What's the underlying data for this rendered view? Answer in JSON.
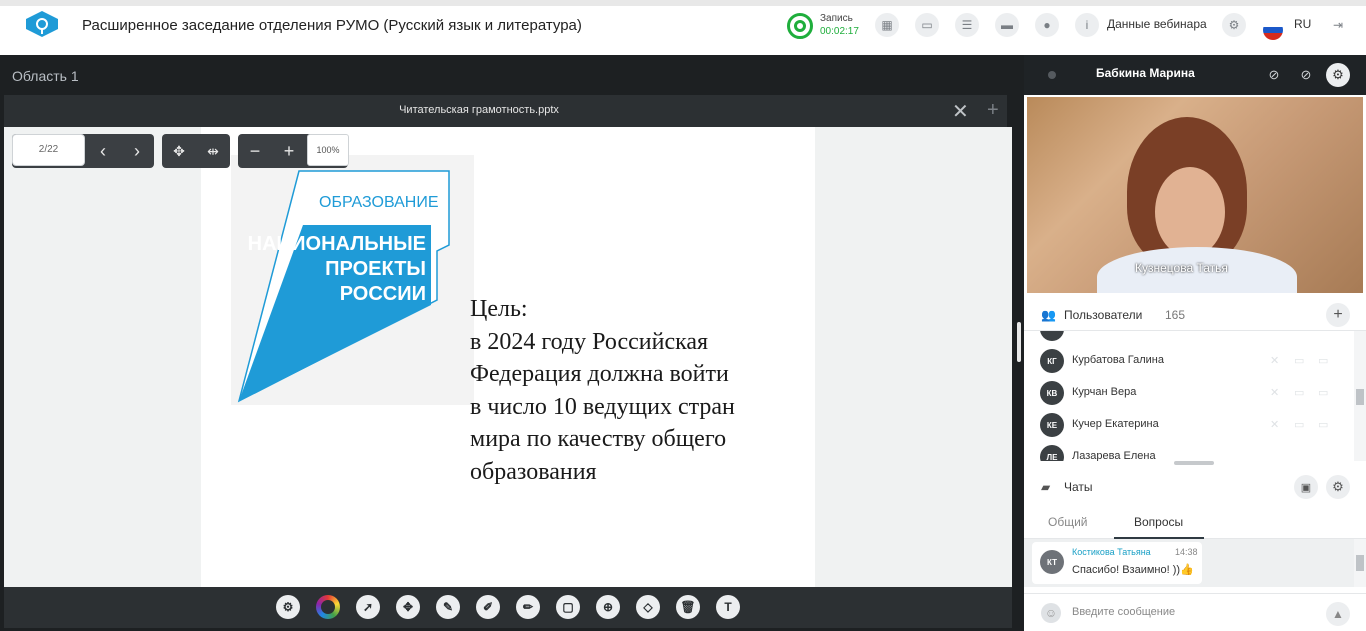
{
  "header": {
    "title": "Расширенное заседание отделения РУМО (Русский язык и литература)",
    "record_label": "Запись",
    "record_time": "00:02:17",
    "webinar_data": "Данные вебинара",
    "language": "RU"
  },
  "workspace": {
    "area_label": "Область 1"
  },
  "presentation": {
    "file_name": "Читательская грамотность.pptx",
    "page_indicator": "2/22",
    "zoom": "100%",
    "slide_logo_top": "ОБРАЗОВАНИЕ",
    "slide_logo_lines": [
      "НАЦИОНАЛЬНЫЕ",
      "ПРОЕКТЫ",
      "РОССИИ"
    ],
    "slide_text_lines": [
      "Цель:",
      "в 2024 году Российская",
      "Федерация должна войти",
      "в число 10 ведущих стран",
      "мира по качеству общего",
      "образования"
    ]
  },
  "speaker": {
    "name": "Бабкина Марина",
    "video_label": "Кузнецова Татья"
  },
  "users": {
    "title": "Пользователи",
    "count": "165",
    "list": [
      {
        "initials": "КГ",
        "name": "Курбатова Галина"
      },
      {
        "initials": "КВ",
        "name": "Курчан Вера"
      },
      {
        "initials": "КЕ",
        "name": "Кучер Екатерина"
      },
      {
        "initials": "ЛЕ",
        "name": "Лазарева Елена"
      }
    ]
  },
  "chats": {
    "title": "Чаты",
    "tabs": [
      "Общий",
      "Вопросы"
    ],
    "active_tab": "Вопросы",
    "message": {
      "initials": "КТ",
      "author": "Костикова Татьяна",
      "time": "14:38",
      "text": "Спасибо! Взаимно! ))"
    },
    "input_placeholder": "Введите сообщение"
  },
  "colors": {
    "accent_green": "#1fae3c",
    "dark_bg": "#1d2022",
    "panel_dark": "#2c3033",
    "link_blue": "#1aa0c6",
    "logo_blue": "#1f9bd7"
  },
  "icons": {
    "logo": "webinar-logo-icon",
    "toolbar": [
      "settings-icon",
      "color-picker-icon",
      "pointer-icon",
      "move-icon",
      "brush-icon",
      "pen-icon",
      "marker-icon",
      "shape-icon",
      "target-icon",
      "eraser-icon",
      "trash-icon",
      "text-icon"
    ]
  }
}
